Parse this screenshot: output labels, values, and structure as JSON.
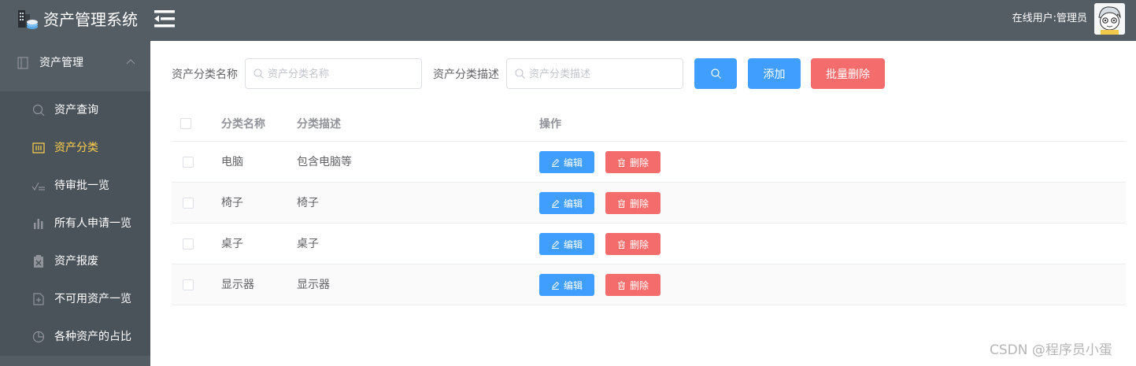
{
  "header": {
    "app_title": "资产管理系统",
    "online_user": "在线用户:管理员"
  },
  "sidebar": {
    "group_label": "资产管理",
    "items": [
      {
        "label": "资产查询",
        "icon": "search-icon"
      },
      {
        "label": "资产分类",
        "icon": "category-icon",
        "active": true
      },
      {
        "label": "待审批一览",
        "icon": "approval-icon"
      },
      {
        "label": "所有人申请一览",
        "icon": "bar-chart-icon"
      },
      {
        "label": "资产报废",
        "icon": "scrap-icon"
      },
      {
        "label": "不可用资产一览",
        "icon": "document-icon"
      },
      {
        "label": "各种资产的占比",
        "icon": "pie-chart-icon"
      }
    ],
    "active_color": "#ffd04b"
  },
  "search": {
    "name_label": "资产分类名称",
    "name_placeholder": "资产分类名称",
    "name_value": "",
    "desc_label": "资产分类描述",
    "desc_placeholder": "资产分类描述",
    "desc_value": "",
    "add_label": "添加",
    "batch_delete_label": "批量删除"
  },
  "table": {
    "columns": [
      "分类名称",
      "分类描述",
      "操作"
    ],
    "rows": [
      {
        "name": "电脑",
        "description": "包含电脑等"
      },
      {
        "name": "椅子",
        "description": "椅子"
      },
      {
        "name": "桌子",
        "description": "桌子"
      },
      {
        "name": "显示器",
        "description": "显示器"
      }
    ],
    "edit_label": "编辑",
    "delete_label": "删除"
  },
  "watermark": "CSDN @程序员小蛋",
  "colors": {
    "header_bg": "#545c64",
    "primary": "#409eff",
    "danger": "#f56c6c"
  }
}
